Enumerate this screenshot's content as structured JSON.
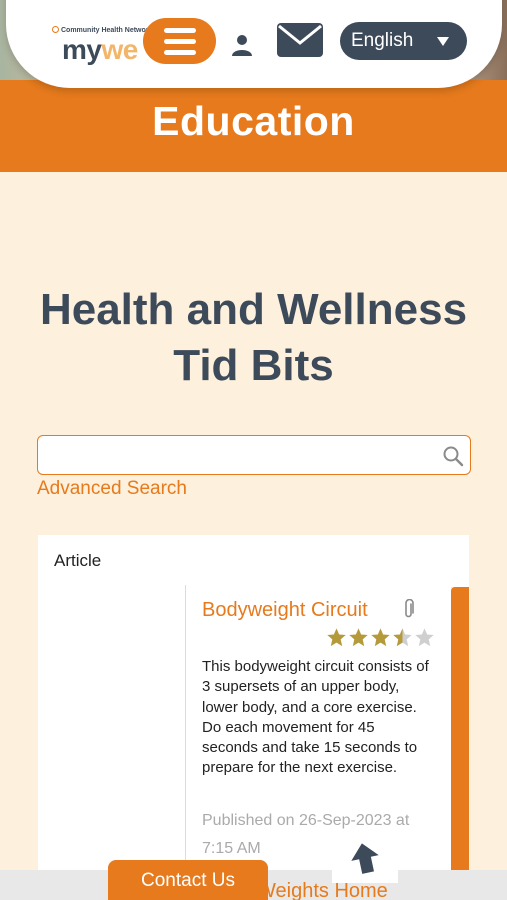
{
  "header": {
    "logo_tag": "Community Health Network",
    "logo_my": "my",
    "logo_we": "we",
    "language": "English"
  },
  "banner": {
    "title": "Education"
  },
  "main": {
    "title": "Health and Wellness Tid Bits",
    "search": {
      "value": "",
      "placeholder": ""
    },
    "advanced_search": "Advanced Search"
  },
  "articles": {
    "label": "Article",
    "items": [
      {
        "title": "Bodyweight Circuit",
        "rating": 3.5,
        "rating_max": 5,
        "description": "This bodyweight circuit consists of 3 supersets of an upper body, lower body, and a core exercise. Do each movement for 45 seconds and take 15 seconds to prepare for the next exercise.",
        "published": "Published on 26-Sep-2023 at 7:15 AM"
      },
      {
        "title": "Weights Home"
      }
    ]
  },
  "footer": {
    "contact_label": "Contact Us"
  },
  "colors": {
    "accent": "#e67a1c",
    "navy": "#3d4a5a",
    "background": "#fdf0dc",
    "star_filled": "#b59a3c",
    "star_empty": "#cfcfcf"
  },
  "icons": [
    "menu-icon",
    "user-icon",
    "mail-icon",
    "caret-down-icon",
    "search-icon",
    "paperclip-icon",
    "star-icon",
    "back-to-top-icon"
  ]
}
